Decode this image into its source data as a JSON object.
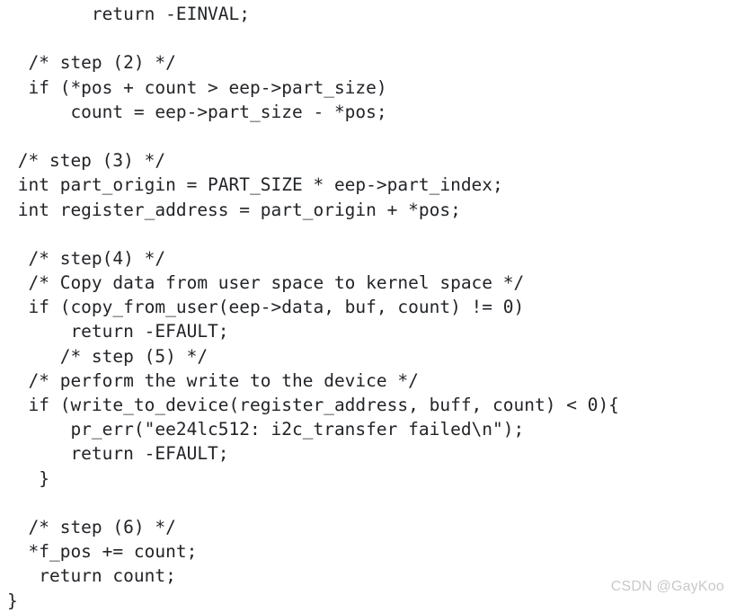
{
  "code_block": {
    "language": "c",
    "text_color": "#222428",
    "background_color": "#ffffff",
    "lines": [
      "        return -EINVAL;",
      "",
      "  /* step (2) */",
      "  if (*pos + count > eep->part_size)",
      "      count = eep->part_size - *pos;",
      "",
      " /* step (3) */",
      " int part_origin = PART_SIZE * eep->part_index;",
      " int register_address = part_origin + *pos;",
      "",
      "  /* step(4) */",
      "  /* Copy data from user space to kernel space */",
      "  if (copy_from_user(eep->data, buf, count) != 0)",
      "      return -EFAULT;",
      "     /* step (5) */",
      "  /* perform the write to the device */",
      "  if (write_to_device(register_address, buff, count) < 0){",
      "      pr_err(\"ee24lc512: i2c_transfer failed\\n\");",
      "      return -EFAULT;",
      "   }",
      "",
      "  /* step (6) */",
      "  *f_pos += count;",
      "   return count;",
      "}"
    ]
  },
  "watermark": {
    "label": "CSDN @GayKoo",
    "color": "#c9c9c9"
  }
}
